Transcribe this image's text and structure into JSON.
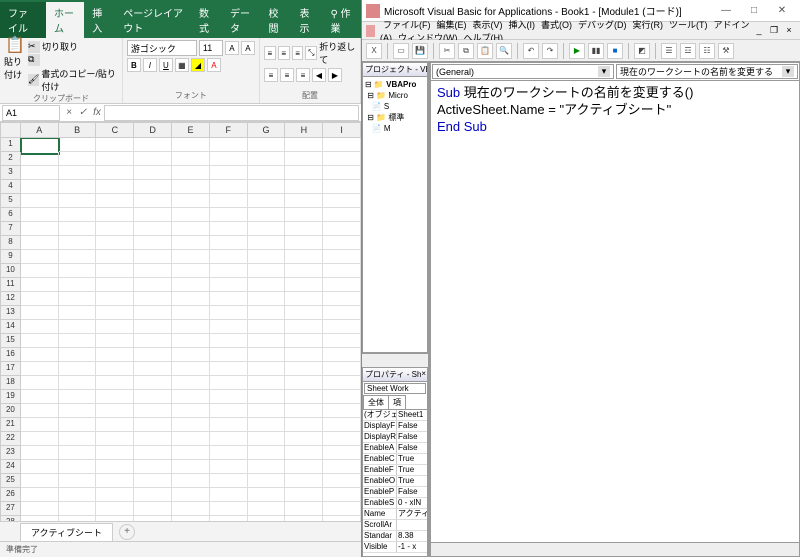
{
  "excel": {
    "tabs": {
      "file": "ファイル",
      "home": "ホーム",
      "insert": "挿入",
      "pagelayout": "ページレイアウト",
      "formulas": "数式",
      "data": "データ",
      "review": "校閲",
      "view": "表示",
      "tell": "作業"
    },
    "clipboard": {
      "paste": "貼り付け",
      "cut": "切り取り",
      "copy": "書式のコピー/貼り付け",
      "group": "クリップボード"
    },
    "font": {
      "name": "游ゴシック",
      "size": "11",
      "group": "フォント"
    },
    "align": {
      "wrap": "折り返して",
      "group": "配置"
    },
    "search_tell": "⚲ 作業",
    "namebox": "A1",
    "columns": [
      "A",
      "B",
      "C",
      "D",
      "E",
      "F",
      "G",
      "H",
      "I"
    ],
    "rowcount": 30,
    "sheet_tab": "アクティブシート",
    "status": "準備完了"
  },
  "vbe": {
    "title": "Microsoft Visual Basic for Applications - Book1 - [Module1 (コード)]",
    "menu": [
      "ファイル(F)",
      "編集(E)",
      "表示(V)",
      "挿入(I)",
      "書式(O)",
      "デバッグ(D)",
      "実行(R)",
      "ツール(T)",
      "アドイン(A)",
      "ウィンドウ(W)",
      "ヘルプ(H)"
    ],
    "project": {
      "title": "プロジェクト - VB",
      "root": "VBAPro",
      "items": [
        "Micro",
        "S",
        "標準",
        "M"
      ]
    },
    "properties": {
      "title": "プロパティ - Sh",
      "object": "Sheet Work",
      "tabs": [
        "全体",
        "項"
      ],
      "rows": [
        [
          "(オブジェ",
          "Sheet1"
        ],
        [
          "DisplayF",
          "False"
        ],
        [
          "DisplayR",
          "False"
        ],
        [
          "EnableA",
          "False"
        ],
        [
          "EnableC",
          "True"
        ],
        [
          "EnableF",
          "True"
        ],
        [
          "EnableO",
          "True"
        ],
        [
          "EnableP",
          "False"
        ],
        [
          "EnableS",
          "0 - xlN"
        ],
        [
          "Name",
          "アクティ"
        ],
        [
          "ScrollAr",
          ""
        ],
        [
          "Standar",
          "8.38"
        ],
        [
          "Visible",
          "-1 - x"
        ]
      ]
    },
    "code": {
      "dd_left": "(General)",
      "dd_right": "現在のワークシートの名前を変更する",
      "line1_kw": "Sub",
      "line1_rest": " 現在のワークシートの名前を変更する()",
      "line2": "ActiveSheet.Name = \"アクティブシート\"",
      "line3": "End Sub"
    }
  }
}
